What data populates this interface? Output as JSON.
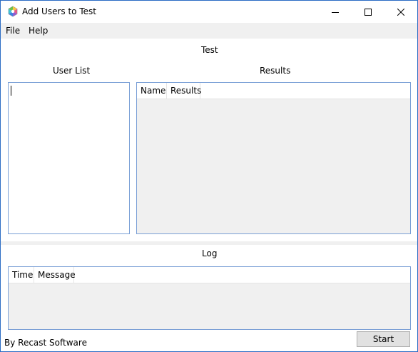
{
  "window": {
    "title": "Add Users to Test",
    "icon": "hexagon-app-icon",
    "controls": [
      "minimize-icon",
      "maximize-icon",
      "close-icon"
    ]
  },
  "menu": {
    "items": [
      {
        "label": "File"
      },
      {
        "label": "Help"
      }
    ]
  },
  "main": {
    "section_title": "Test",
    "user_list_label": "User List",
    "results_label": "Results",
    "results_columns": [
      "Name",
      "Results"
    ]
  },
  "log": {
    "title": "Log",
    "columns": [
      "Time",
      "Message"
    ]
  },
  "footer": {
    "credit": "By Recast Software",
    "start_label": "Start"
  },
  "colors": {
    "border_accent": "#2b6cc4",
    "control_border": "#7a9fd6",
    "panel_bg": "#f0f0f0",
    "button_bg": "#e1e1e1"
  }
}
